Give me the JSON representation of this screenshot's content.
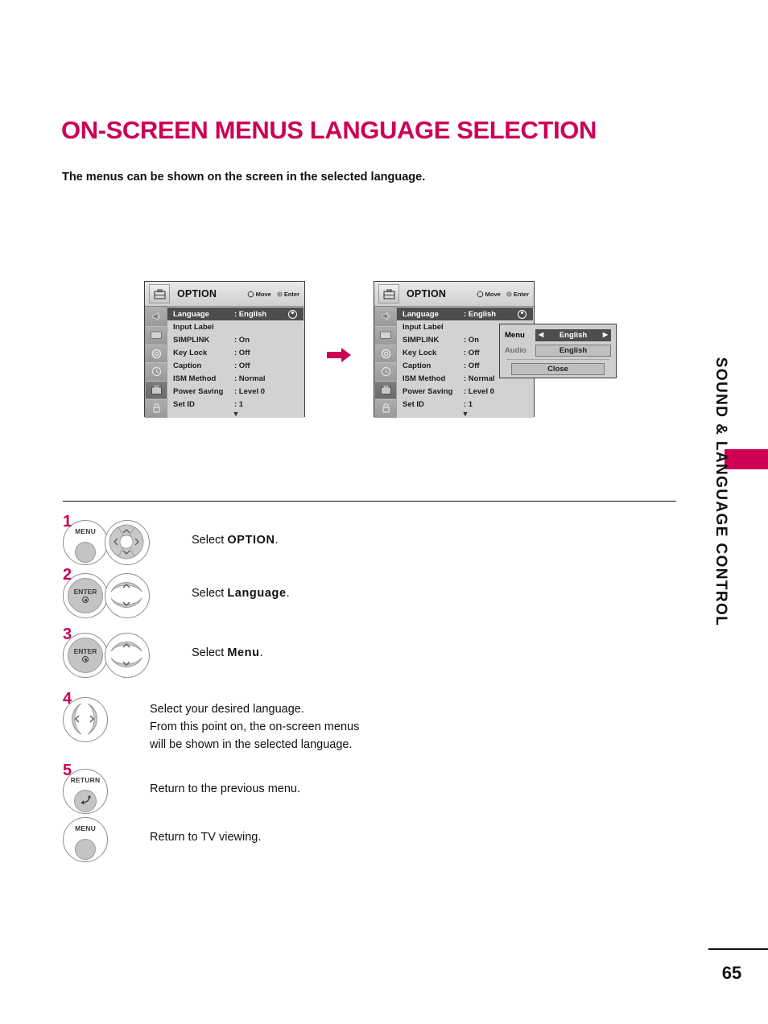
{
  "page": {
    "title": "ON-SCREEN MENUS LANGUAGE SELECTION",
    "subtitle": "The menus can be shown on the screen in the selected language.",
    "number": "65",
    "side_tab_label": "SOUND & LANGUAGE CONTROL",
    "accent_color": "#cc0055"
  },
  "osd": {
    "title": "OPTION",
    "hints": {
      "move": "Move",
      "enter": "Enter"
    },
    "rail_icons": [
      "audio-speaker-icon",
      "picture-screen-icon",
      "setup-gear-icon",
      "time-clock-icon",
      "option-briefcase-icon",
      "lock-user-icon"
    ],
    "rail_active_index": 4,
    "rows": [
      {
        "label": "Language",
        "value": ": English",
        "selected": true
      },
      {
        "label": "Input Label",
        "value": "",
        "selected": false
      },
      {
        "label": "SIMPLINK",
        "value": ": On",
        "selected": false
      },
      {
        "label": "Key Lock",
        "value": ": Off",
        "selected": false
      },
      {
        "label": "Caption",
        "value": ": Off",
        "selected": false
      },
      {
        "label": "ISM Method",
        "value": ": Normal",
        "selected": false
      },
      {
        "label": "Power Saving",
        "value": ": Level 0",
        "selected": false
      },
      {
        "label": "Set ID",
        "value": ": 1",
        "selected": false
      }
    ],
    "scroll_down_glyph": "▼"
  },
  "language_popup": {
    "menu_label": "Menu",
    "menu_value": "English",
    "audio_label": "Audio",
    "audio_value": "English",
    "close_label": "Close",
    "left_arrow": "◀",
    "right_arrow": "▶"
  },
  "steps": [
    {
      "num": "1",
      "button_caption": "MENU",
      "button_type": "menu-with-dpad",
      "text_prefix": "Select ",
      "text_bold": "OPTION",
      "text_suffix": "."
    },
    {
      "num": "2",
      "button_caption": "ENTER",
      "button_type": "enter-with-updown",
      "text_prefix": "Select ",
      "text_bold": "Language",
      "text_suffix": "."
    },
    {
      "num": "3",
      "button_caption": "ENTER",
      "button_type": "enter-with-updown",
      "text_prefix": "Select ",
      "text_bold": "Menu",
      "text_suffix": "."
    },
    {
      "num": "4",
      "button_caption": "",
      "button_type": "leftright",
      "line1": "Select your desired language.",
      "line2": "From this point on, the on-screen menus",
      "line3": "will be shown in the selected language."
    },
    {
      "num": "5",
      "button_caption": "RETURN",
      "button_type": "return",
      "text": "Return to the previous menu."
    },
    {
      "num": "",
      "button_caption": "MENU",
      "button_type": "menu",
      "text": "Return to TV viewing."
    }
  ]
}
